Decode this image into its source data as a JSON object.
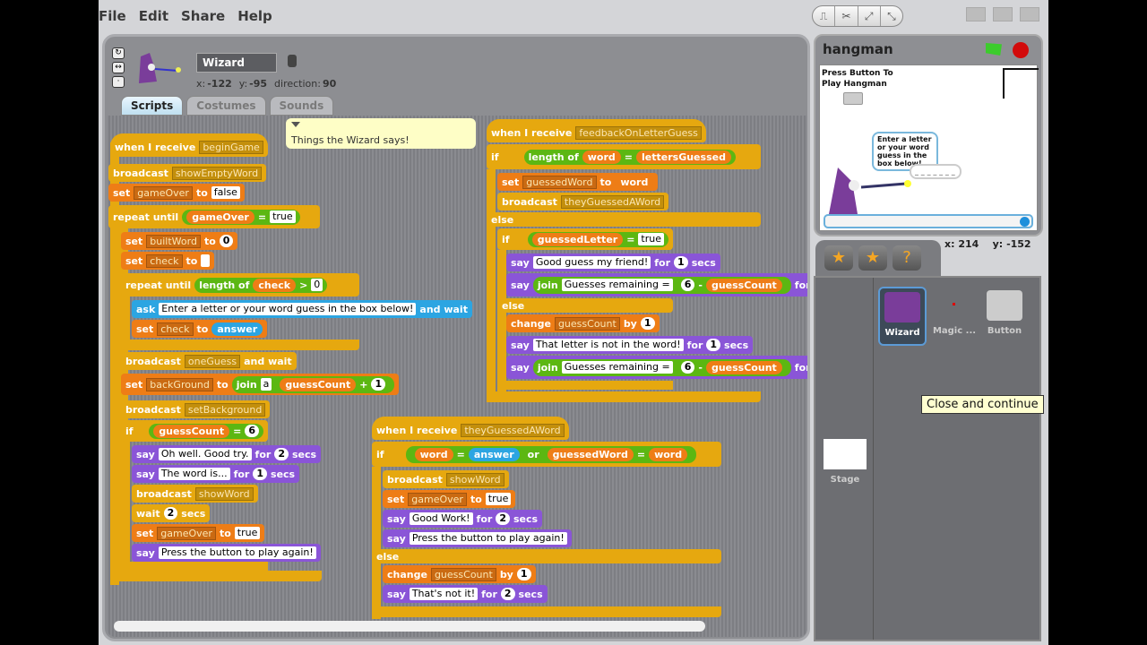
{
  "menu": [
    "File",
    "Edit",
    "Share",
    "Help"
  ],
  "toolbar": {
    "icons": [
      "stamp-icon",
      "scissors-icon",
      "grow-icon",
      "shrink-icon"
    ]
  },
  "sprite": {
    "name": "Wizard",
    "x_label": "x:",
    "x": "-122",
    "y_label": "y:",
    "y": "-95",
    "dir_label": "direction:",
    "direction": "90"
  },
  "tabs": [
    "Scripts",
    "Costumes",
    "Sounds"
  ],
  "comment": "Things the Wizard says!",
  "script1": {
    "hat": "when I receive",
    "hat_msg": "beginGame",
    "b1": "broadcast",
    "b1m": "showEmptyWord",
    "s1": "set",
    "s1v": "gameOver",
    "to": "to",
    "s1val": "false",
    "rep": "repeat until",
    "rv": "gameOver",
    "eq": "=",
    "rval": "true",
    "s2v": "builtWord",
    "s2val": "0",
    "s3v": "check",
    "rep2": "repeat until",
    "lenof": "length of",
    "gt": ">",
    "r2val": "0",
    "ask": "ask",
    "askq": "Enter a letter or your word guess in the box below!",
    "andwait": "and wait",
    "answer": "answer",
    "b2m": "oneGuess",
    "b3m": "setBackground",
    "s4v": "backGround",
    "join": "join",
    "joina": "a",
    "gc": "guessCount",
    "plus": "+",
    "one": "1",
    "if": "if",
    "six": "6",
    "say": "say",
    "say1": "Oh well. Good try.",
    "for": "for",
    "two": "2",
    "secs": "secs",
    "say2": "The word is...",
    "b4m": "showWord",
    "wait": "wait",
    "true": "true",
    "say3": "Press the button to play again!"
  },
  "script2": {
    "hat": "when I receive",
    "hat_msg": "feedbackOnLetterGuess",
    "if": "if",
    "lenof": "length of",
    "word": "word",
    "eq": "=",
    "lg": "lettersGuessed",
    "set": "set",
    "gw": "guessedWord",
    "to": "to",
    "bc": "broadcast",
    "tgw": "theyGuessedAWord",
    "else": "else",
    "gl": "guessedLetter",
    "true": "true",
    "say": "say",
    "s1": "Good guess my friend!",
    "for": "for",
    "one": "1",
    "secs": "secs",
    "join": "join",
    "gr": "Guesses remaining =",
    "six": "6",
    "minus": "-",
    "gc": "guessCount",
    "change": "change",
    "by": "by",
    "s3": "That letter is not in the word!"
  },
  "script3": {
    "hat": "when I receive",
    "hat_msg": "theyGuessedAWord",
    "if": "if",
    "word": "word",
    "eq": "=",
    "answer": "answer",
    "or": "or",
    "gw": "guessedWord",
    "bc": "broadcast",
    "sw": "showWord",
    "set": "set",
    "go": "gameOver",
    "to": "to",
    "true": "true",
    "say": "say",
    "gwk": "Good Work!",
    "for": "for",
    "two": "2",
    "secs": "secs",
    "pba": "Press the button to play again!",
    "else": "else",
    "change": "change",
    "gc": "guessCount",
    "by": "by",
    "one": "1",
    "nit": "That's not it!"
  },
  "stage": {
    "title": "hangman",
    "text": "Press Button To Play Hangman",
    "bubble1": "Enter a letter or your word guess in the box below!",
    "bubble2": "_ _ _ _ _ _ _",
    "ask_value": ""
  },
  "mouse": {
    "x_label": "x:",
    "x": "214",
    "y_label": "y:",
    "y": "-152"
  },
  "sprites": [
    {
      "name": "Wizard",
      "selected": true
    },
    {
      "name": "Magic ..."
    },
    {
      "name": "Button"
    }
  ],
  "stage_tile": "Stage",
  "tooltip": "Close and continue"
}
